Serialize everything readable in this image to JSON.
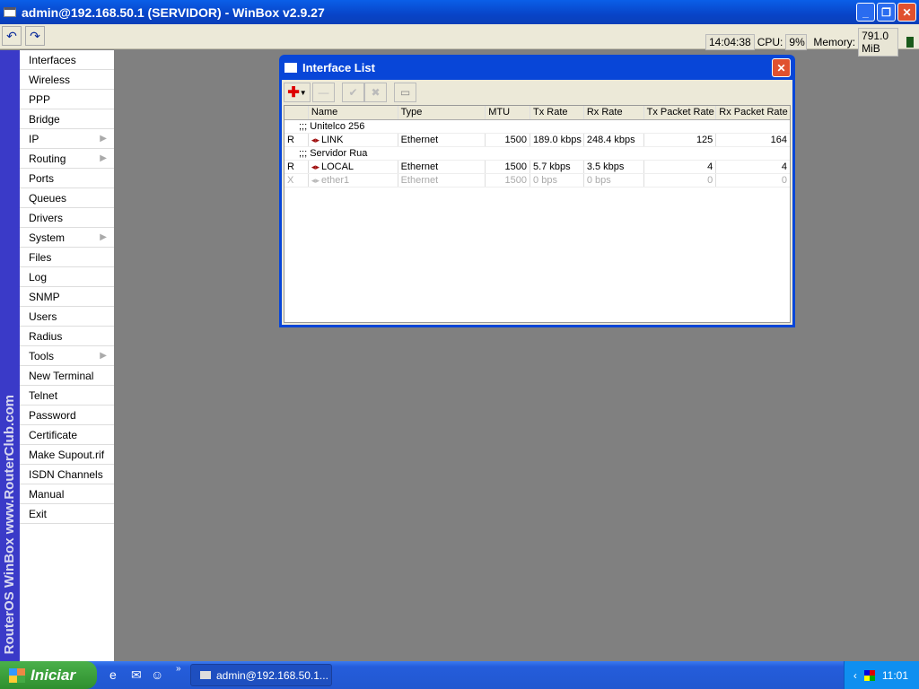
{
  "title": "admin@192.168.50.1 (SERVIDOR) - WinBox v2.9.27",
  "toolbar": {
    "undo": "↶",
    "redo": "↷",
    "time": "14:04:38",
    "cpu_label": "CPU:",
    "cpu": "9%",
    "memory_label": "Memory:",
    "memory": "791.0 MiB"
  },
  "sidebar": {
    "brand": "RouterOS WinBox   www.RouterClub.com",
    "items": [
      {
        "label": "Interfaces"
      },
      {
        "label": "Wireless"
      },
      {
        "label": "PPP"
      },
      {
        "label": "Bridge"
      },
      {
        "label": "IP",
        "sub": true
      },
      {
        "label": "Routing",
        "sub": true
      },
      {
        "label": "Ports"
      },
      {
        "label": "Queues"
      },
      {
        "label": "Drivers"
      },
      {
        "label": "System",
        "sub": true
      },
      {
        "label": "Files"
      },
      {
        "label": "Log"
      },
      {
        "label": "SNMP"
      },
      {
        "label": "Users"
      },
      {
        "label": "Radius"
      },
      {
        "label": "Tools",
        "sub": true
      },
      {
        "label": "New Terminal"
      },
      {
        "label": "Telnet"
      },
      {
        "label": "Password"
      },
      {
        "label": "Certificate"
      },
      {
        "label": "Make Supout.rif"
      },
      {
        "label": "ISDN Channels"
      },
      {
        "label": "Manual"
      },
      {
        "label": "Exit"
      }
    ]
  },
  "window": {
    "title": "Interface List",
    "columns": [
      "",
      "Name",
      "Type",
      "MTU",
      "Tx Rate",
      "Rx Rate",
      "Tx Packet Rate",
      "Rx Packet Rate"
    ],
    "rows": [
      {
        "comment": ";;; Unitelco 256"
      },
      {
        "flag": "R",
        "name": "LINK",
        "type": "Ethernet",
        "mtu": "1500",
        "tx": "189.0 kbps",
        "rx": "248.4 kbps",
        "txp": "125",
        "rxp": "164"
      },
      {
        "comment": ";;; Servidor Rua"
      },
      {
        "flag": "R",
        "name": "LOCAL",
        "type": "Ethernet",
        "mtu": "1500",
        "tx": "5.7 kbps",
        "rx": "3.5 kbps",
        "txp": "4",
        "rxp": "4"
      },
      {
        "flag": "X",
        "name": "ether1",
        "type": "Ethernet",
        "mtu": "1500",
        "tx": "0 bps",
        "rx": "0 bps",
        "txp": "0",
        "rxp": "0",
        "disabled": true
      }
    ]
  },
  "taskbar": {
    "start": "Iniciar",
    "task": "admin@192.168.50.1...",
    "clock": "11:01"
  }
}
